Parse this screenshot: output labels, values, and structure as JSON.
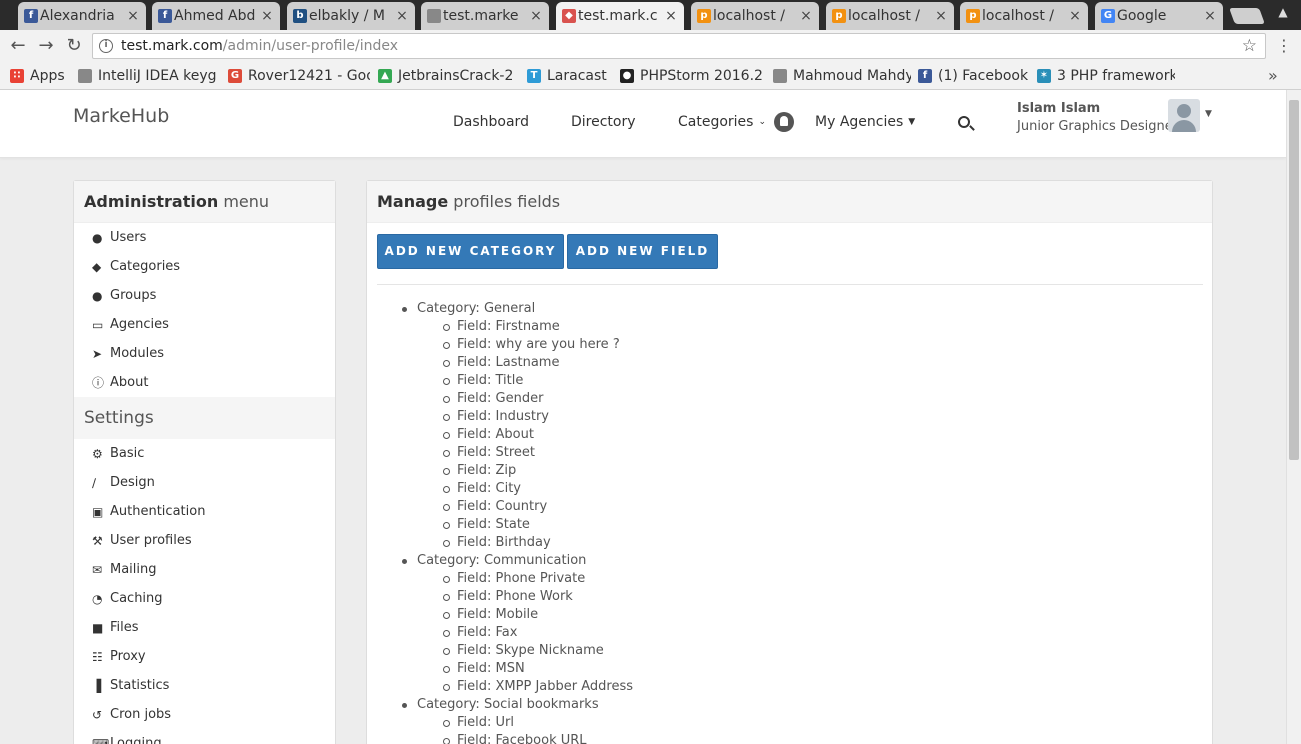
{
  "browser": {
    "tabs": [
      {
        "label": "Alexandria",
        "icon": "facebook-icon",
        "color": "#3b5998",
        "glyph": "f"
      },
      {
        "label": "Ahmed Abd",
        "icon": "facebook-icon",
        "color": "#3b5998",
        "glyph": "f"
      },
      {
        "label": "elbakly / M",
        "icon": "bitbucket-icon",
        "color": "#205081",
        "glyph": "b"
      },
      {
        "label": "test.marke",
        "icon": "page-icon",
        "color": "#888888",
        "glyph": ""
      },
      {
        "label": "test.mark.c",
        "icon": "site-icon",
        "color": "#d9534f",
        "glyph": "◆"
      },
      {
        "label": "localhost /",
        "icon": "phpmyadmin-icon",
        "color": "#f29111",
        "glyph": "p"
      },
      {
        "label": "localhost /",
        "icon": "phpmyadmin-icon",
        "color": "#f29111",
        "glyph": "p"
      },
      {
        "label": "localhost /",
        "icon": "phpmyadmin-icon",
        "color": "#f29111",
        "glyph": "p"
      },
      {
        "label": "Google",
        "icon": "google-icon",
        "color": "#4285f4",
        "glyph": "G"
      }
    ],
    "url_host": "test.mark.com",
    "url_path": "/admin/user-profile/index",
    "bookmarks": [
      {
        "label": "Apps",
        "icon": "apps-icon",
        "color": "#e94235",
        "glyph": "∷"
      },
      {
        "label": "IntelliJ IDEA keyg",
        "icon": "page-icon",
        "color": "#888888",
        "glyph": ""
      },
      {
        "label": "Rover12421 - Goo",
        "icon": "google-plus-icon",
        "color": "#dd4b39",
        "glyph": "G"
      },
      {
        "label": "JetbrainsCrack-2",
        "icon": "drive-icon",
        "color": "#34a853",
        "glyph": "▲"
      },
      {
        "label": "Laracast",
        "icon": "laracast-icon",
        "color": "#2e9bd6",
        "glyph": "T"
      },
      {
        "label": "PHPStorm 2016.2",
        "icon": "github-icon",
        "color": "#222222",
        "glyph": "●"
      },
      {
        "label": "Mahmoud Mahdy",
        "icon": "page-icon",
        "color": "#888888",
        "glyph": ""
      },
      {
        "label": "(1) Facebook",
        "icon": "facebook-icon",
        "color": "#3b5998",
        "glyph": "f"
      },
      {
        "label": "3 PHP framework",
        "icon": "site-icon",
        "color": "#2a8fb8",
        "glyph": "✶"
      }
    ]
  },
  "site": {
    "brand": "MarkeHub",
    "nav": {
      "dashboard": "Dashboard",
      "directory": "Directory",
      "categories": "Categories",
      "agencies": "My Agencies"
    },
    "user": {
      "name": "Islam Islam",
      "title": "Junior Graphics Designer"
    }
  },
  "sidebar": {
    "heading_bold": "Administration",
    "heading_rest": " menu",
    "admin_items": [
      {
        "label": "Users",
        "icon": "user-icon"
      },
      {
        "label": "Categories",
        "icon": "tags-icon"
      },
      {
        "label": "Groups",
        "icon": "users-icon"
      },
      {
        "label": "Agencies",
        "icon": "inbox-icon"
      },
      {
        "label": "Modules",
        "icon": "rocket-icon"
      },
      {
        "label": "About",
        "icon": "info-icon"
      }
    ],
    "settings_heading": "Settings",
    "settings_items": [
      {
        "label": "Basic",
        "icon": "cogs-icon"
      },
      {
        "label": "Design",
        "icon": "magic-icon"
      },
      {
        "label": "Authentication",
        "icon": "lock-icon"
      },
      {
        "label": "User profiles",
        "icon": "wrench-icon"
      },
      {
        "label": "Mailing",
        "icon": "envelope-icon"
      },
      {
        "label": "Caching",
        "icon": "dashboard-icon"
      },
      {
        "label": "Files",
        "icon": "file-icon"
      },
      {
        "label": "Proxy",
        "icon": "sitemap-icon"
      },
      {
        "label": "Statistics",
        "icon": "bar-chart-icon"
      },
      {
        "label": "Cron jobs",
        "icon": "history-icon"
      },
      {
        "label": "Logging",
        "icon": "keyboard-icon"
      }
    ]
  },
  "main": {
    "heading_bold": "Manage",
    "heading_rest": " profiles fields",
    "add_category_label": "ADD NEW CATEGORY",
    "add_field_label": "ADD NEW FIELD",
    "categories": [
      {
        "label": "Category: General",
        "fields": [
          "Field: Firstname",
          "Field: why are you here ?",
          "Field: Lastname",
          "Field: Title",
          "Field: Gender",
          "Field: Industry",
          "Field: About",
          "Field: Street",
          "Field: Zip",
          "Field: City",
          "Field: Country",
          "Field: State",
          "Field: Birthday"
        ]
      },
      {
        "label": "Category: Communication",
        "fields": [
          "Field: Phone Private",
          "Field: Phone Work",
          "Field: Mobile",
          "Field: Fax",
          "Field: Skype Nickname",
          "Field: MSN",
          "Field: XMPP Jabber Address"
        ]
      },
      {
        "label": "Category: Social bookmarks",
        "fields": [
          "Field: Url",
          "Field: Facebook URL"
        ]
      }
    ]
  },
  "colors": {
    "primary_button": "#3479b7",
    "panel_heading_bg": "#f5f5f5",
    "page_bg": "#ededed"
  }
}
